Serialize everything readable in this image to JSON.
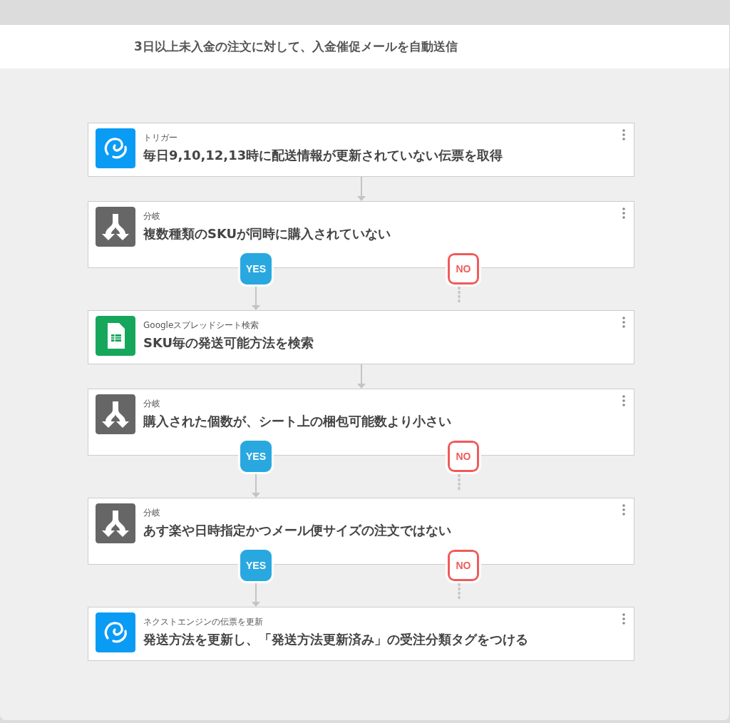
{
  "title": "3日以上未入金の注文に対して、入金催促メールを自動送信",
  "steps": [
    {
      "kind": "trigger",
      "label": "トリガー",
      "text": "毎日9,10,12,13時に配送情報が更新されていない伝票を取得"
    },
    {
      "kind": "branch",
      "label": "分岐",
      "text": "複数種類のSKUが同時に購入されていない",
      "yes": "YES",
      "no": "NO"
    },
    {
      "kind": "sheets",
      "label": "Googleスプレッドシート検索",
      "text": "SKU毎の発送可能方法を検索"
    },
    {
      "kind": "branch",
      "label": "分岐",
      "text": "購入された個数が、シート上の梱包可能数より小さい",
      "yes": "YES",
      "no": "NO"
    },
    {
      "kind": "branch",
      "label": "分岐",
      "text": "あす楽や日時指定かつメール便サイズの注文ではない",
      "yes": "YES",
      "no": "NO"
    },
    {
      "kind": "action",
      "label": "ネクストエンジンの伝票を更新",
      "text": "発送方法を更新し、「発送方法更新済み」の受注分類タグをつける"
    }
  ]
}
